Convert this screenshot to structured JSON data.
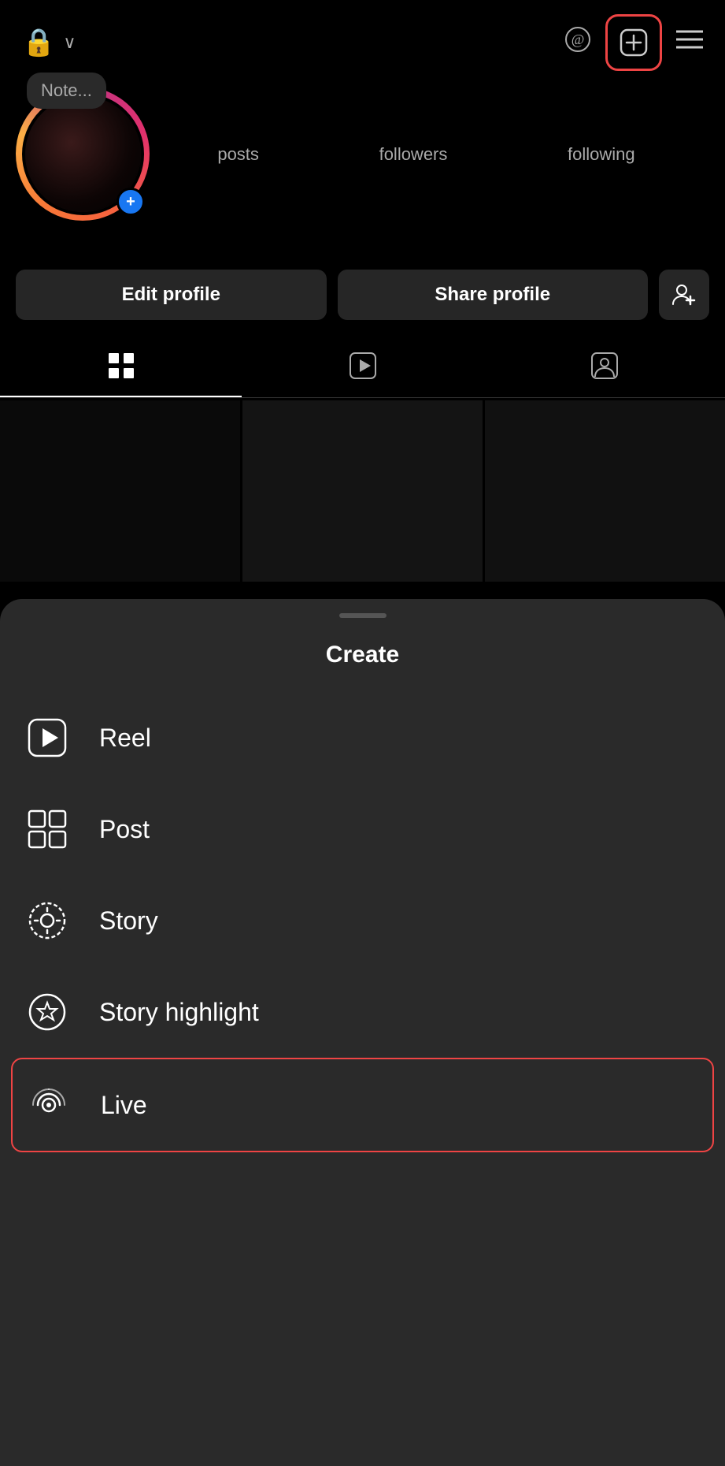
{
  "topbar": {
    "lock_icon": "🔒",
    "dropdown_arrow": "∨",
    "threads_label": "threads-icon",
    "add_button_label": "⊞",
    "menu_label": "☰"
  },
  "profile": {
    "note_placeholder": "Note...",
    "stats": [
      {
        "value": "",
        "label": "posts"
      },
      {
        "value": "",
        "label": "followers"
      },
      {
        "value": "",
        "label": "following"
      }
    ]
  },
  "buttons": {
    "edit_profile": "Edit profile",
    "share_profile": "Share profile",
    "add_person_icon": "👤+"
  },
  "tabs": [
    {
      "name": "grid",
      "icon": "⊞",
      "active": true
    },
    {
      "name": "reels",
      "icon": "▶",
      "active": false
    },
    {
      "name": "tagged",
      "icon": "👤",
      "active": false
    }
  ],
  "bottom_sheet": {
    "title": "Create",
    "items": [
      {
        "id": "reel",
        "label": "Reel",
        "highlighted": false
      },
      {
        "id": "post",
        "label": "Post",
        "highlighted": false
      },
      {
        "id": "story",
        "label": "Story",
        "highlighted": false
      },
      {
        "id": "story-highlight",
        "label": "Story highlight",
        "highlighted": false
      },
      {
        "id": "live",
        "label": "Live",
        "highlighted": true
      }
    ]
  }
}
